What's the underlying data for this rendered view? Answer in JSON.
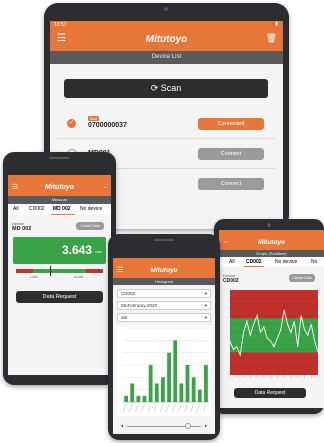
{
  "tablet": {
    "status_time": "10:57",
    "brand": "Mitutoyo",
    "subtitle": "Device List",
    "scan_label": "Scan",
    "devices": [
      {
        "tag": "Bad",
        "name": "0700000037",
        "action": "Connected",
        "state": "connected"
      },
      {
        "tag": "",
        "name": "MD001",
        "action": "Connect",
        "state": "idle"
      },
      {
        "tag": "",
        "name": "",
        "action": "Connect",
        "state": "idle"
      }
    ]
  },
  "phone_left": {
    "brand": "Mitutoyo",
    "subtitle": "Measure",
    "tabs": [
      "All",
      "CD002",
      "MD 002",
      "No device"
    ],
    "device_label": "Device",
    "device_name": "MD 002",
    "cancel_label": "Cancel Data",
    "reading": "3.643",
    "unit": "mm",
    "range_low": "1.000",
    "range_high": "10.000",
    "data_request_label": "Data Request"
  },
  "phone_center": {
    "brand": "Mitutoyo",
    "subtitle": "Histogram",
    "select_device": "CD002",
    "select_date": "08-February-2020",
    "select_option": "dat",
    "chart_data": {
      "type": "bar",
      "values": [
        1,
        3,
        1,
        1,
        6,
        3,
        4,
        8,
        10,
        3,
        6,
        4,
        2,
        6
      ],
      "ylim": [
        0,
        12
      ],
      "grid": true
    }
  },
  "tablet_right": {
    "brand": "Mitutoyo",
    "subtitle": "Graph (Realtime)",
    "tabs": [
      "All",
      "CD002",
      "No device",
      "No"
    ],
    "device_label": "Device",
    "device_name": "CD002",
    "cancel_label": "Cancel Data",
    "data_request_label": "Data Request",
    "chart_data": {
      "type": "line",
      "values": [
        1.2,
        0.9,
        1.0,
        0.7,
        1.5,
        1.9,
        1.4,
        1.8,
        2.1,
        1.5,
        1.7,
        1.3,
        1.2,
        1.0,
        1.3,
        1.6,
        2.3,
        1.8,
        1.5,
        1.9,
        1.0,
        2.1,
        1.6,
        1.4,
        1.8,
        1.2,
        0.8
      ],
      "ylim": [
        0,
        3
      ],
      "bands": {
        "upper": 2.0,
        "lower": 0.8
      }
    }
  },
  "colors": {
    "brand": "#e7763b",
    "ok": "#3aa34a",
    "ng": "#c0302c"
  }
}
